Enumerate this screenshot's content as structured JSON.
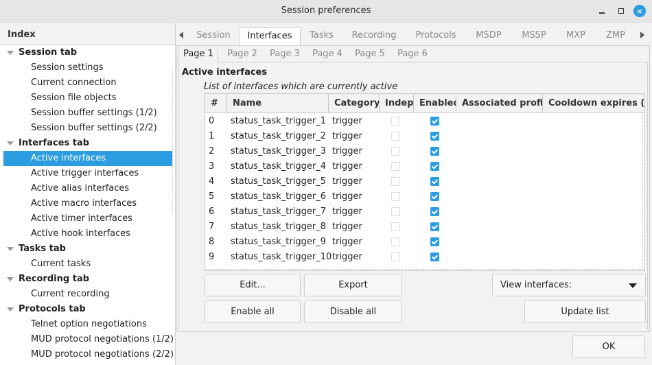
{
  "window": {
    "title": "Session preferences",
    "controls": {
      "minimize": "minimize",
      "maximize": "maximize",
      "close": "×"
    }
  },
  "index": {
    "header": "Index",
    "groups": [
      {
        "label": "Session tab",
        "items": [
          "Session settings",
          "Current connection",
          "Session file objects",
          "Session buffer settings (1/2)",
          "Session buffer settings (2/2)"
        ]
      },
      {
        "label": "Interfaces tab",
        "items": [
          "Active interfaces",
          "Active trigger interfaces",
          "Active alias interfaces",
          "Active macro interfaces",
          "Active timer interfaces",
          "Active hook interfaces"
        ]
      },
      {
        "label": "Tasks tab",
        "items": [
          "Current tasks"
        ]
      },
      {
        "label": "Recording tab",
        "items": [
          "Current recording"
        ]
      },
      {
        "label": "Protocols tab",
        "items": [
          "Telnet option negotiations",
          "MUD protocol negotiations (1/2)",
          "MUD protocol negotiations (2/2)"
        ]
      }
    ],
    "selected": "Active interfaces"
  },
  "tabs": [
    "Session",
    "Interfaces",
    "Tasks",
    "Recording",
    "Protocols",
    "MSDP",
    "MSSP",
    "MXP",
    "ZMP"
  ],
  "active_tab": "Interfaces",
  "subtabs": [
    "Page 1",
    "Page 2",
    "Page 3",
    "Page 4",
    "Page 5",
    "Page 6"
  ],
  "active_subtab": "Page 1",
  "section": {
    "title": "Active interfaces",
    "subtitle": "List of interfaces which are currently active"
  },
  "table": {
    "columns": [
      "#",
      "Name",
      "Category",
      "Indep",
      "Enabled",
      "Associated profile",
      "Cooldown expires (sec"
    ],
    "rows": [
      {
        "num": "0",
        "name": "status_task_trigger_1",
        "category": "trigger",
        "indep": false,
        "enabled": true,
        "profile": "",
        "cooldown": ""
      },
      {
        "num": "1",
        "name": "status_task_trigger_2",
        "category": "trigger",
        "indep": false,
        "enabled": true,
        "profile": "",
        "cooldown": ""
      },
      {
        "num": "2",
        "name": "status_task_trigger_3",
        "category": "trigger",
        "indep": false,
        "enabled": true,
        "profile": "",
        "cooldown": ""
      },
      {
        "num": "3",
        "name": "status_task_trigger_4",
        "category": "trigger",
        "indep": false,
        "enabled": true,
        "profile": "",
        "cooldown": ""
      },
      {
        "num": "4",
        "name": "status_task_trigger_5",
        "category": "trigger",
        "indep": false,
        "enabled": true,
        "profile": "",
        "cooldown": ""
      },
      {
        "num": "5",
        "name": "status_task_trigger_6",
        "category": "trigger",
        "indep": false,
        "enabled": true,
        "profile": "",
        "cooldown": ""
      },
      {
        "num": "6",
        "name": "status_task_trigger_7",
        "category": "trigger",
        "indep": false,
        "enabled": true,
        "profile": "",
        "cooldown": ""
      },
      {
        "num": "7",
        "name": "status_task_trigger_8",
        "category": "trigger",
        "indep": false,
        "enabled": true,
        "profile": "",
        "cooldown": ""
      },
      {
        "num": "8",
        "name": "status_task_trigger_9",
        "category": "trigger",
        "indep": false,
        "enabled": true,
        "profile": "",
        "cooldown": ""
      },
      {
        "num": "9",
        "name": "status_task_trigger_10",
        "category": "trigger",
        "indep": false,
        "enabled": true,
        "profile": "",
        "cooldown": ""
      }
    ]
  },
  "buttons": {
    "edit": "Edit...",
    "export": "Export",
    "enable_all": "Enable all",
    "disable_all": "Disable all",
    "view_interfaces": "View interfaces:",
    "update_list": "Update list",
    "ok": "OK"
  },
  "colors": {
    "accent": "#2c9de0"
  }
}
